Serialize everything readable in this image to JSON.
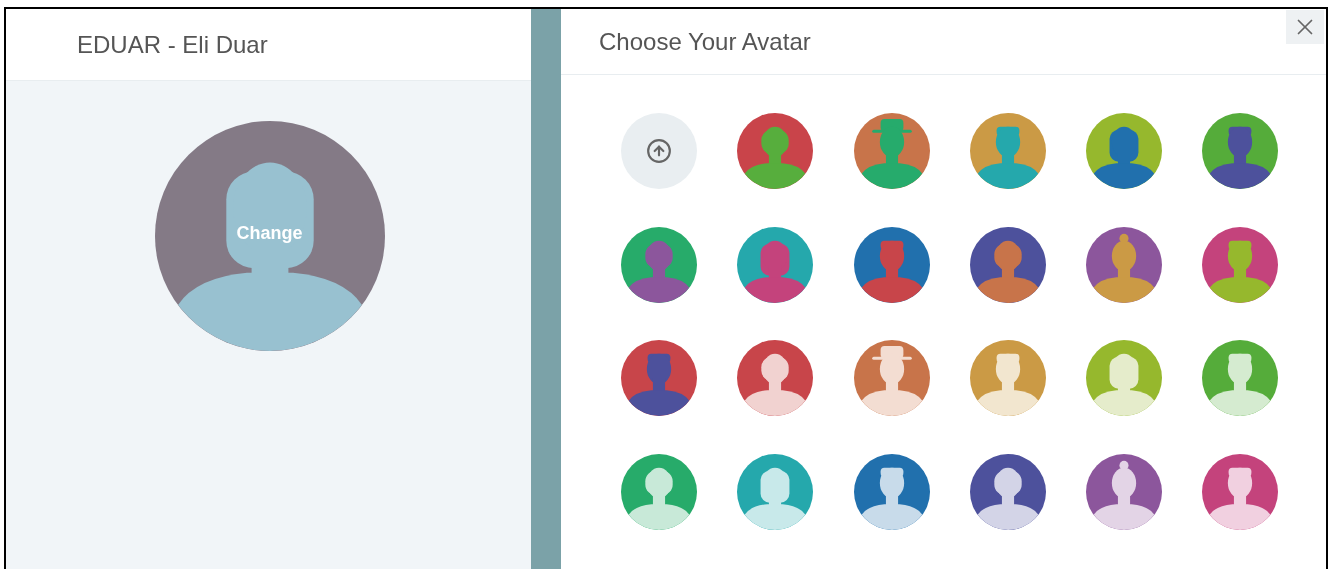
{
  "profile": {
    "title": "EDUAR - Eli Duar",
    "avatar": {
      "kind": "long",
      "color": "#847a86",
      "figure": {
        "color": "#98c1d0"
      }
    },
    "change_label": "Change"
  },
  "dialog": {
    "title": "Choose Your Avatar",
    "avatars": [
      {
        "kind": "upload"
      },
      {
        "kind": "short",
        "color": "#c9444a",
        "figure": {
          "color": "#57ae3d"
        }
      },
      {
        "kind": "hat",
        "color": "#c8744a",
        "figure": {
          "color": "#26ab6c"
        }
      },
      {
        "kind": "male",
        "color": "#cb9a45",
        "figure": {
          "color": "#25a8ac"
        }
      },
      {
        "kind": "long",
        "color": "#96b82d",
        "figure": {
          "color": "#2170ad"
        }
      },
      {
        "kind": "male",
        "color": "#55ac3a",
        "figure": {
          "color": "#4d519c"
        }
      },
      {
        "kind": "short",
        "color": "#27ab6a",
        "figure": {
          "color": "#8c569c"
        }
      },
      {
        "kind": "long",
        "color": "#25a8ac",
        "figure": {
          "color": "#c4437c"
        }
      },
      {
        "kind": "male",
        "color": "#2170ad",
        "figure": {
          "color": "#c8454a"
        }
      },
      {
        "kind": "short",
        "color": "#4d519c",
        "figure": {
          "color": "#c8744a"
        }
      },
      {
        "kind": "bun",
        "color": "#8c569c",
        "figure": {
          "color": "#cb9a45"
        }
      },
      {
        "kind": "male",
        "color": "#c4437c",
        "figure": {
          "color": "#96b82d"
        }
      },
      {
        "kind": "male",
        "color": "#c8454a",
        "figure": {
          "color": "#4d519c"
        }
      },
      {
        "kind": "short",
        "color": "#c8454a",
        "figure": {
          "color": "#f1d2d0"
        }
      },
      {
        "kind": "hat",
        "color": "#c8744a",
        "figure": {
          "color": "#f3ddd2"
        }
      },
      {
        "kind": "male",
        "color": "#cb9a45",
        "figure": {
          "color": "#f2e6cf"
        }
      },
      {
        "kind": "long",
        "color": "#96b82d",
        "figure": {
          "color": "#e5eccb"
        }
      },
      {
        "kind": "male",
        "color": "#55ac3a",
        "figure": {
          "color": "#d5ebd0"
        }
      },
      {
        "kind": "short",
        "color": "#27ab6a",
        "figure": {
          "color": "#c8e9d8"
        }
      },
      {
        "kind": "long",
        "color": "#25a8ac",
        "figure": {
          "color": "#c8e9ea"
        }
      },
      {
        "kind": "male",
        "color": "#2170ad",
        "figure": {
          "color": "#c8dbea"
        }
      },
      {
        "kind": "short",
        "color": "#4d519c",
        "figure": {
          "color": "#d3d4e7"
        }
      },
      {
        "kind": "bun",
        "color": "#8c569c",
        "figure": {
          "color": "#e3d4e6"
        }
      },
      {
        "kind": "male",
        "color": "#c4437c",
        "figure": {
          "color": "#f1d0e0"
        }
      }
    ]
  }
}
